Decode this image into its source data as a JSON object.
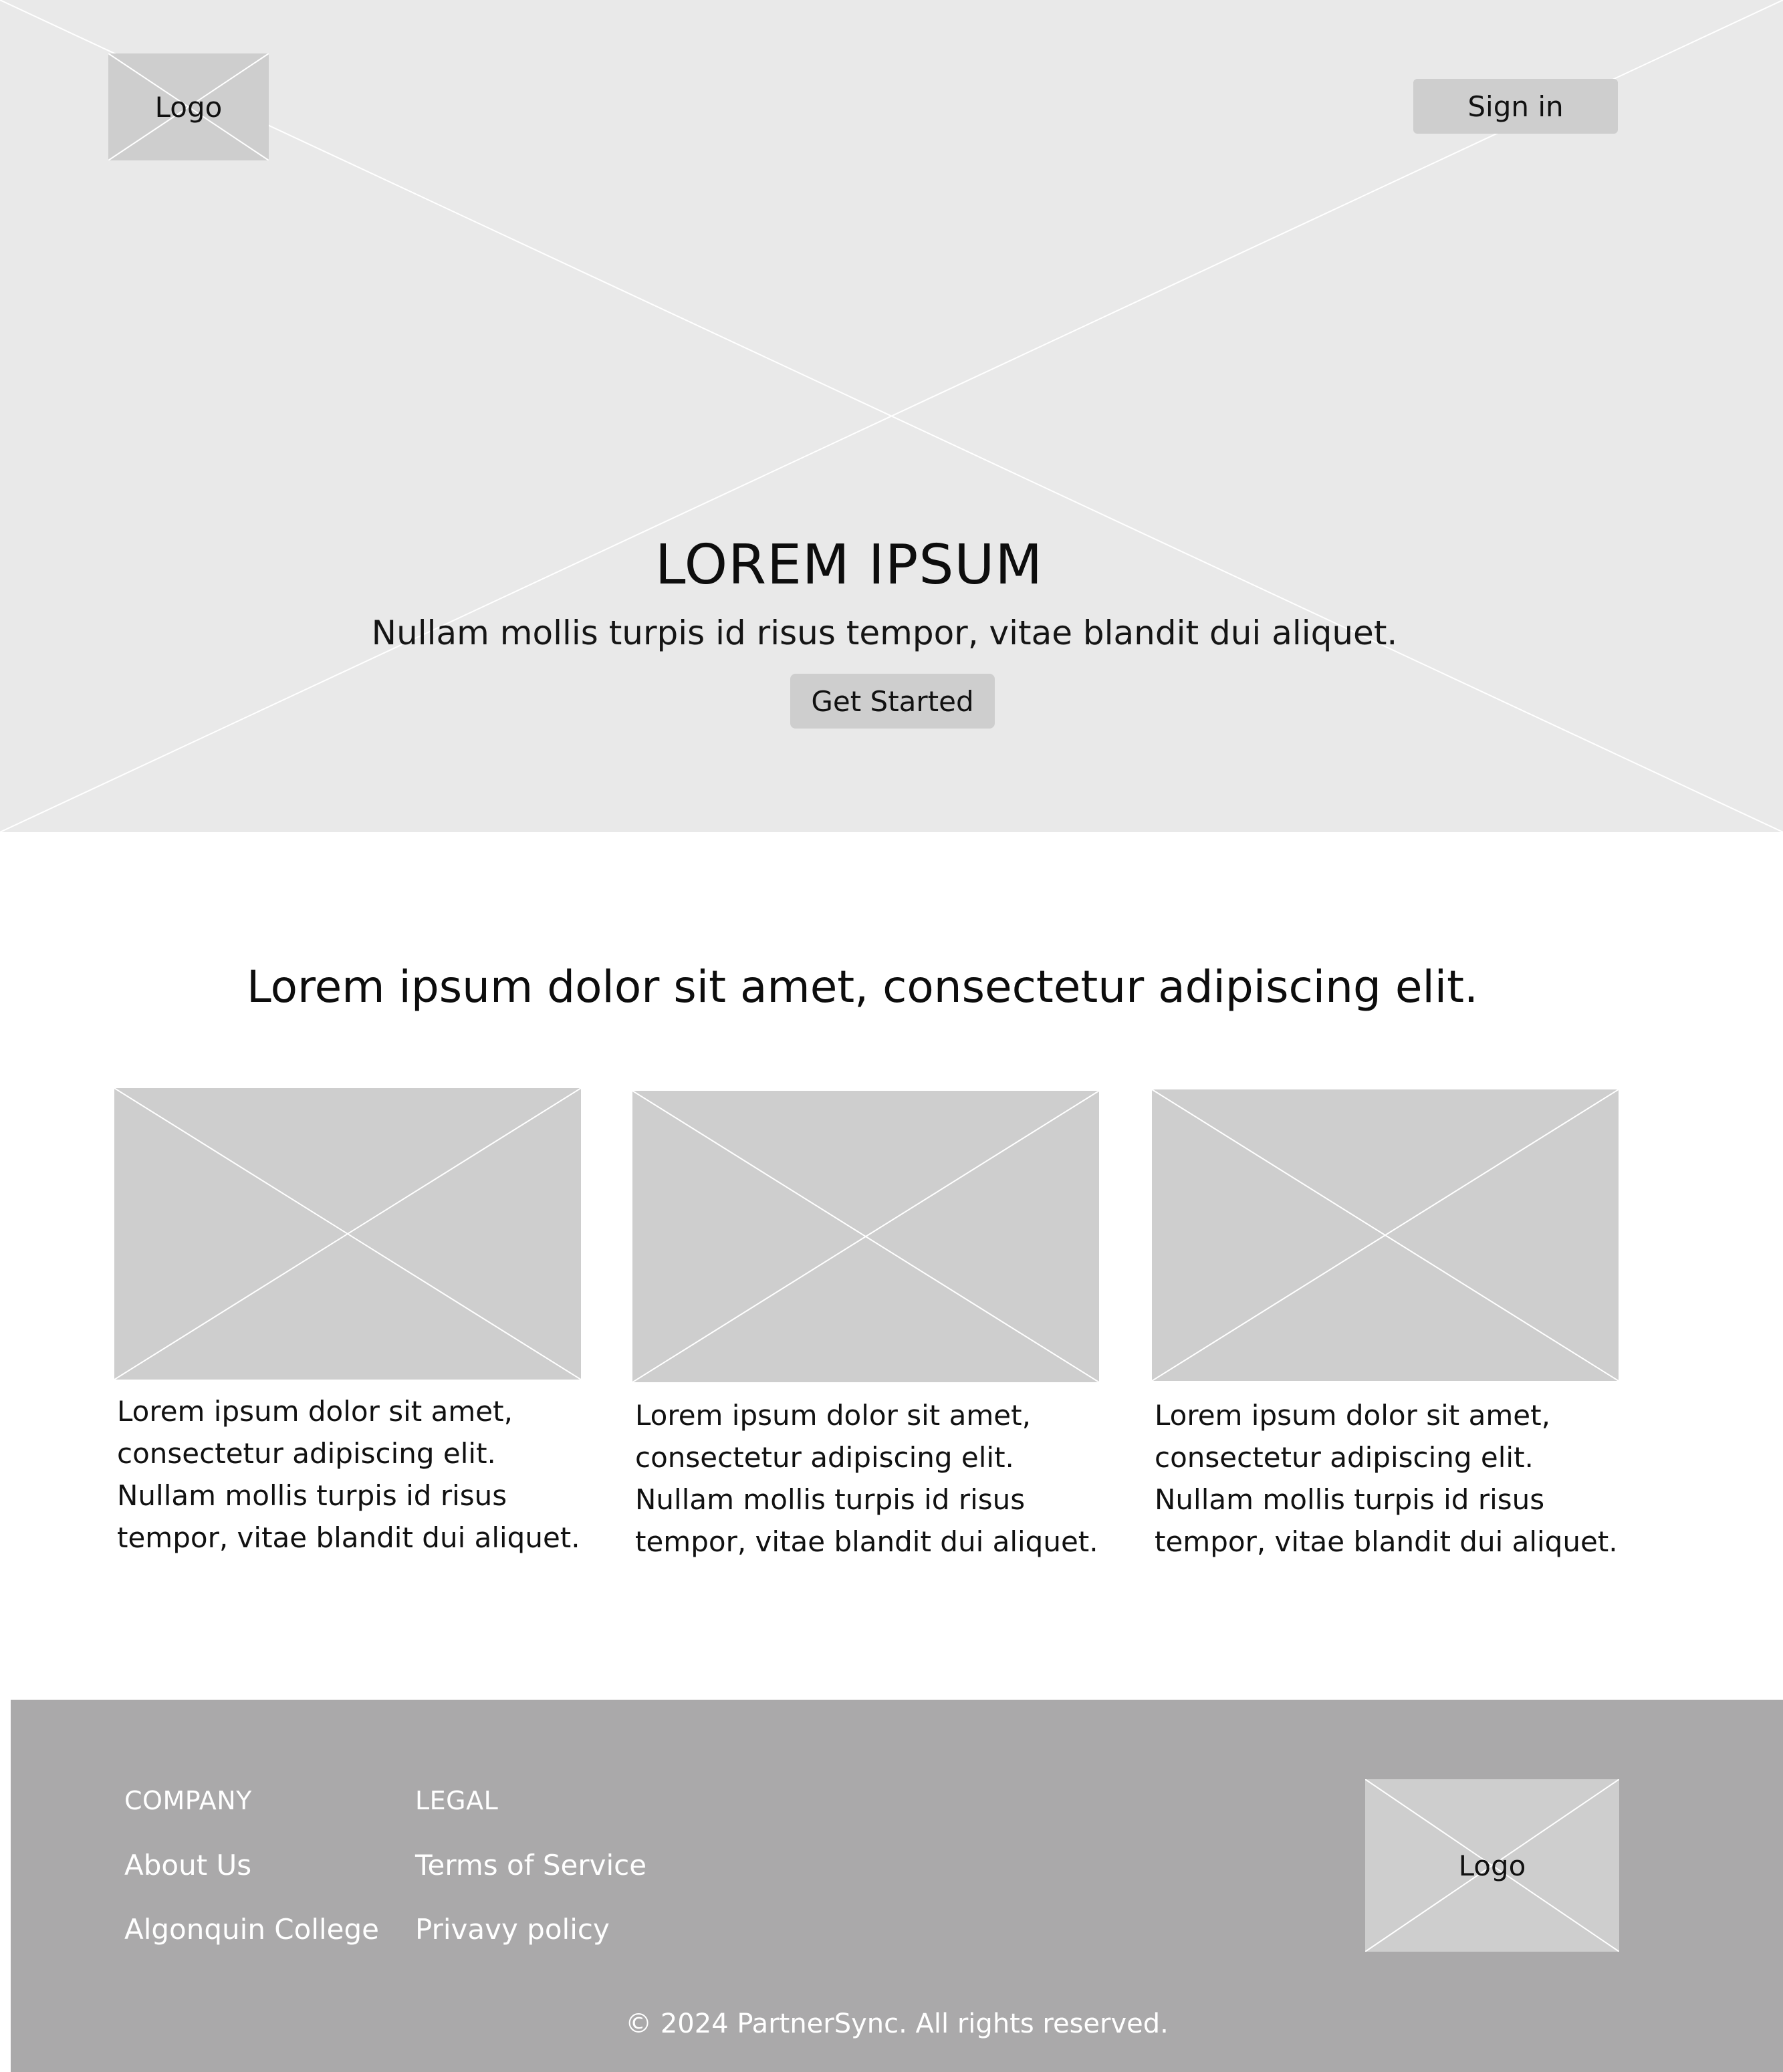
{
  "header": {
    "logo_label": "Logo",
    "signin_label": "Sign in"
  },
  "hero": {
    "title": "LOREM IPSUM",
    "subtitle": "Nullam mollis turpis id risus tempor, vitae blandit dui aliquet.",
    "cta_label": "Get Started"
  },
  "features": {
    "heading": "Lorem ipsum dolor sit amet, consectetur adipiscing elit.",
    "cards": [
      {
        "lines": [
          "Lorem ipsum dolor sit amet,",
          "consectetur adipiscing elit.",
          "Nullam mollis turpis id risus",
          "tempor, vitae blandit dui aliquet."
        ]
      },
      {
        "lines": [
          "Lorem ipsum dolor sit amet,",
          "consectetur adipiscing elit.",
          "Nullam mollis turpis id risus",
          "tempor, vitae blandit dui aliquet."
        ]
      },
      {
        "lines": [
          "Lorem ipsum dolor sit amet,",
          "consectetur adipiscing elit.",
          "Nullam mollis turpis id risus",
          "tempor, vitae blandit dui aliquet."
        ]
      }
    ]
  },
  "footer": {
    "company": {
      "title": "COMPANY",
      "links": [
        "About Us",
        "Algonquin College"
      ]
    },
    "legal": {
      "title": "LEGAL",
      "links": [
        "Terms of Service",
        "Privavy policy"
      ]
    },
    "logo_label": "Logo",
    "copyright": "© 2024 PartnerSync. All rights reserved."
  },
  "colors": {
    "hero_bg": "#e9e9e9",
    "placeholder_fill": "#cecece",
    "footer_bg": "#aaa9aa",
    "footer_text": "#ffffff"
  }
}
